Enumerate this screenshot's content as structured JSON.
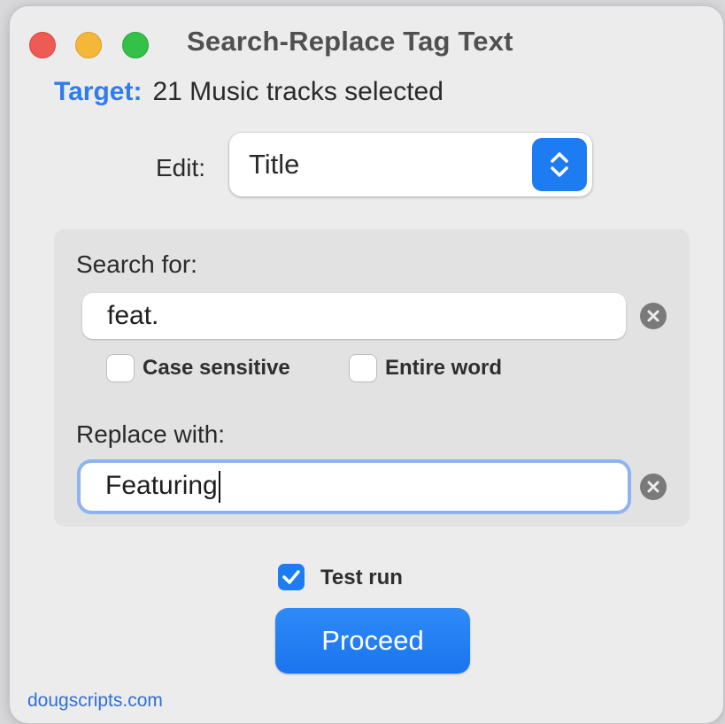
{
  "window": {
    "title": "Search-Replace Tag Text"
  },
  "target": {
    "label": "Target:",
    "value": "21 Music tracks selected"
  },
  "edit": {
    "label": "Edit:",
    "selected": "Title"
  },
  "search": {
    "label": "Search for:",
    "value": "feat.",
    "case_sensitive": {
      "label": "Case sensitive",
      "checked": false
    },
    "entire_word": {
      "label": "Entire word",
      "checked": false
    }
  },
  "replace": {
    "label": "Replace with:",
    "value": "Featuring"
  },
  "test_run": {
    "label": "Test run",
    "checked": true
  },
  "proceed_label": "Proceed",
  "footer": {
    "link": "dougscripts.com"
  },
  "colors": {
    "accent": "#1e7cf2",
    "target_label": "#2f7cf0",
    "close": "#ee5b54",
    "minimize": "#f5b73a",
    "zoom": "#33c148"
  },
  "icons": {
    "close": "close-icon",
    "minimize": "minimize-icon",
    "zoom": "zoom-icon",
    "popup": "chevron-up-down-icon",
    "clear": "clear-x-icon",
    "checkmark": "checkmark-icon"
  }
}
